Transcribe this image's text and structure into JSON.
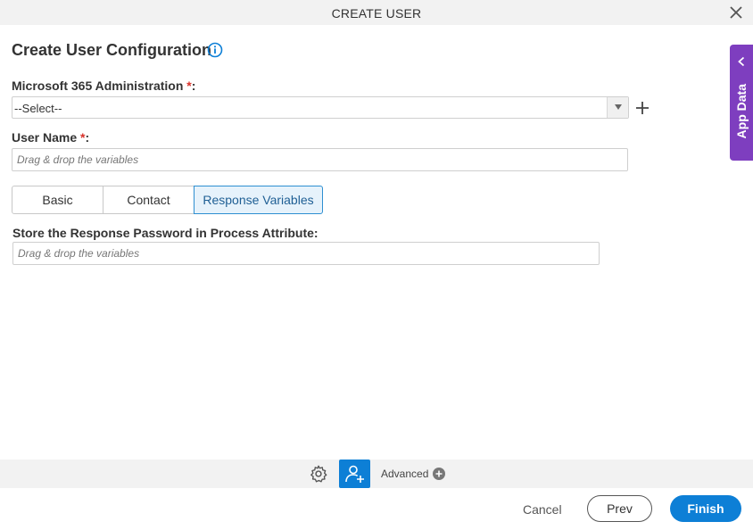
{
  "window": {
    "title": "CREATE USER"
  },
  "heading": "Create User Configuration",
  "fields": {
    "m365": {
      "label": "Microsoft 365 Administration",
      "required_mark": "*",
      "colon": ":",
      "selected": "--Select--"
    },
    "username": {
      "label": "User Name",
      "required_mark": "*",
      "colon": ":",
      "placeholder": "Drag & drop the variables"
    },
    "response_password": {
      "label": "Store the Response Password in Process Attribute:",
      "placeholder": "Drag & drop the variables"
    }
  },
  "tabs": [
    {
      "label": "Basic"
    },
    {
      "label": "Contact"
    },
    {
      "label": "Response Variables"
    }
  ],
  "side_panel": {
    "label": "App Data"
  },
  "bottom_bar": {
    "advanced_label": "Advanced"
  },
  "footer": {
    "cancel": "Cancel",
    "prev": "Prev",
    "finish": "Finish"
  },
  "colors": {
    "accent": "#0d7fd6",
    "side_panel": "#7e3ebf",
    "required": "#d9322a"
  },
  "icons": [
    "close-icon",
    "info-icon",
    "chevron-down-icon",
    "plus-icon",
    "chevron-left-icon",
    "gear-icon",
    "user-add-icon",
    "plus-circle-icon"
  ]
}
